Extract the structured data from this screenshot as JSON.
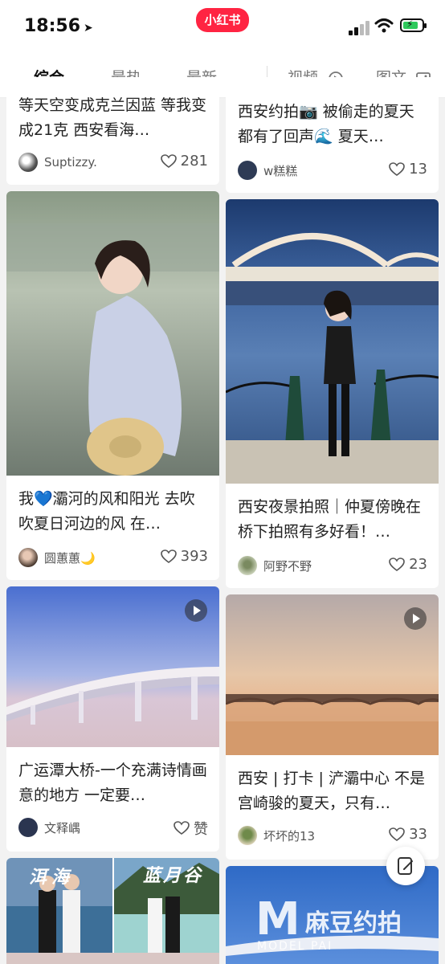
{
  "status_bar": {
    "time": "18:56",
    "logo": "小红书"
  },
  "tabs": [
    {
      "label": "综合",
      "active": true
    },
    {
      "label": "最热",
      "active": false
    },
    {
      "label": "最新",
      "active": false
    },
    {
      "label": "视频",
      "active": false,
      "icon": "play-circle-icon"
    },
    {
      "label": "图文",
      "active": false,
      "icon": "image-icon"
    }
  ],
  "cards": [
    {
      "title": "等天空变成克兰因蓝 等我变成21克 西安看海…",
      "author": "Suptizzy.",
      "likes": "281"
    },
    {
      "title": "西安约拍📷 被偷走的夏天都有了回声🌊 夏天…",
      "author": "w糕糕",
      "likes": "13"
    },
    {
      "title": "我💙灞河的风和阳光 去吹吹夏日河边的风 在…",
      "author": "圆蕙蕙🌙",
      "likes": "393"
    },
    {
      "title": "西安夜景拍照｜仲夏傍晚在桥下拍照有多好看！…",
      "author": "阿野不野",
      "likes": "23"
    },
    {
      "title": "广运潭大桥-一个充满诗情画意的地方 一定要…",
      "author": "文释嵎",
      "likes": "赞"
    },
    {
      "title": "西安 | 打卡 | 浐灞中心 不是宫崎骏的夏天，只有…",
      "author": "坏坏的13",
      "likes": "33"
    },
    {
      "overlay_left": "洱海",
      "overlay_right": "蓝月谷"
    }
  ],
  "watermark": {
    "mark": "M",
    "text": "麻豆约拍",
    "sub": "MODEL PAI"
  },
  "colors": {
    "brand": "#ff2442"
  }
}
